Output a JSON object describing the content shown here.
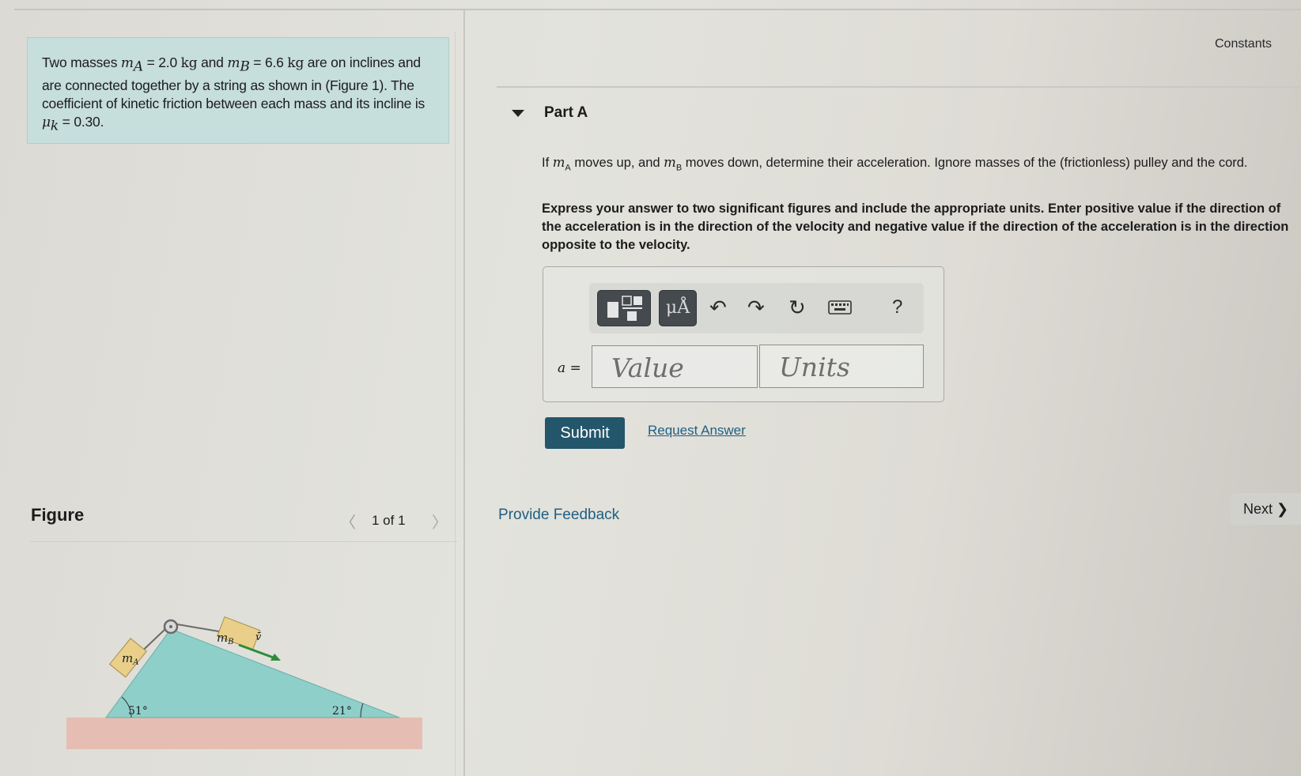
{
  "problem": {
    "t1": "Two masses ",
    "mA_sym": "m",
    "mA_sub": "A",
    "mA_val": " = 2.0 ",
    "kg1": "kg",
    "t2": " and ",
    "mB_sym": "m",
    "mB_sub": "B",
    "mB_val": " = 6.6 ",
    "kg2": "kg",
    "t3": " are on inclines and are connected together by a string as shown in (Figure 1). The coefficient of kinetic friction between each mass and its incline is ",
    "mu_sym": "μ",
    "mu_sub": "k",
    "mu_val": " = 0.30."
  },
  "constants_link": "Constants",
  "part": {
    "title": "Part A",
    "q_if": "If ",
    "q_m1": "m",
    "q_sub1": "A",
    "q_mid": " moves up, and ",
    "q_m2": "m",
    "q_sub2": "B",
    "q_rest": " moves down, determine their acceleration. Ignore masses of the (frictionless) pulley and the cord.",
    "instructions": "Express your answer to two significant figures and include the appropriate units. Enter positive value if the direction of the acceleration is in the direction of the velocity and negative value if the direction of the acceleration is in the direction opposite to the velocity."
  },
  "toolbar": {
    "units_label": "μÅ",
    "undo_glyph": "↶",
    "redo_glyph": "↷",
    "reset_glyph": "↻",
    "help_glyph": "?",
    "icons": [
      "templates-icon",
      "units-icon",
      "undo-icon",
      "redo-icon",
      "reset-icon",
      "keyboard-icon",
      "help-icon"
    ]
  },
  "answer": {
    "var": "a",
    "eq": " =",
    "value_placeholder": "Value",
    "units_placeholder": "Units"
  },
  "buttons": {
    "submit": "Submit",
    "request_answer": "Request Answer",
    "provide_feedback": "Provide Feedback",
    "next": "Next ❯"
  },
  "figure": {
    "title": "Figure",
    "prev": "〈",
    "counter": "1 of 1",
    "next": "〉",
    "label_mA": "m",
    "label_mA_sub": "A",
    "label_mB": "m",
    "label_mB_sub": "B",
    "label_v": "v̄",
    "angle_left": "51°",
    "angle_right": "21°"
  },
  "colors": {
    "problem_bg": "#c6dedc",
    "submit_bg": "#24566b",
    "link": "#1f5f83",
    "incline_fill": "#8ecfc9",
    "ground_fill": "#e6bdb2",
    "block_fill": "#e9cf8a",
    "velocity_arrow": "#2e8b3a"
  }
}
